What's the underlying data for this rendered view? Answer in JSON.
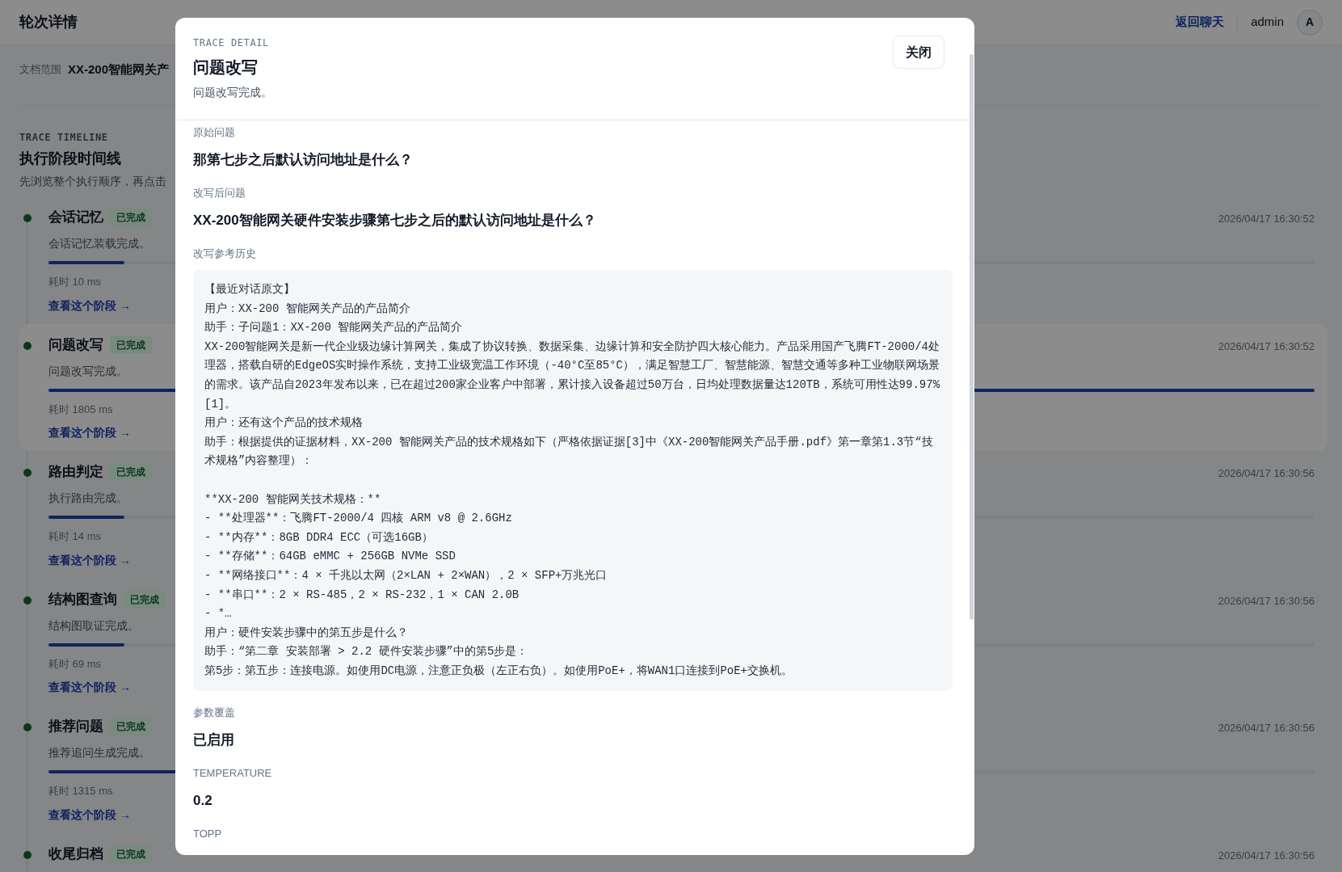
{
  "page": {
    "title": "轮次详情",
    "back_link": "返回聊天",
    "user": "admin",
    "avatar": "A"
  },
  "scope": {
    "label": "文档范围",
    "value": "XX-200智能网关产"
  },
  "timeline": {
    "eyebrow": "TRACE TIMELINE",
    "title": "执行阶段时间线",
    "hint": "先浏览整个执行顺序，再点击"
  },
  "stages": [
    {
      "name": "会话记忆",
      "status": "已完成",
      "desc": "会话记忆装载完成。",
      "level": 0.06,
      "duration": "耗时 10 ms",
      "link": "查看这个阶段 →",
      "time": "2026/04/17 16:30:52",
      "selected": false
    },
    {
      "name": "问题改写",
      "status": "已完成",
      "desc": "问题改写完成。",
      "level": 1,
      "duration": "耗时 1805 ms",
      "link": "查看这个阶段 →",
      "time": "2026/04/17 16:30:52",
      "selected": true
    },
    {
      "name": "路由判定",
      "status": "已完成",
      "desc": "执行路由完成。",
      "level": 0.06,
      "duration": "耗时 14 ms",
      "link": "查看这个阶段 →",
      "time": "2026/04/17 16:30:56",
      "selected": false
    },
    {
      "name": "结构图查询",
      "status": "已完成",
      "desc": "结构图取证完成。",
      "level": 0.06,
      "duration": "耗时 69 ms",
      "link": "查看这个阶段 →",
      "time": "2026/04/17 16:30:56",
      "selected": false
    },
    {
      "name": "推荐问题",
      "status": "已完成",
      "desc": "推荐追问生成完成。",
      "level": 0.73,
      "duration": "耗时 1315 ms",
      "link": "查看这个阶段 →",
      "time": "2026/04/17 16:30:56",
      "selected": false
    },
    {
      "name": "收尾归档",
      "status": "已完成",
      "time": "2026/04/17 16:30:56",
      "selected": false
    }
  ],
  "detail": {
    "eyebrow": "TRACE DETAIL",
    "title": "问题改写",
    "subtitle": "问题改写完成。",
    "close": "关闭",
    "fields": [
      {
        "kind": "text",
        "label": "原始问题",
        "value": "那第七步之后默认访问地址是什么？"
      },
      {
        "kind": "text",
        "label": "改写后问题",
        "value": "XX-200智能网关硬件安装步骤第七步之后的默认访问地址是什么？"
      },
      {
        "kind": "code",
        "label": "改写参考历史",
        "lines": [
          {
            "text": "【最近对话原文】",
            "space_before": false
          },
          {
            "text": "用户：XX-200 智能网关产品的产品简介",
            "space_before": false
          },
          {
            "text": "助手：子问题1：XX-200 智能网关产品的产品简介",
            "space_before": false
          },
          {
            "text": "XX-200智能网关是新一代企业级边缘计算网关，集成了协议转换、数据采集、边缘计算和安全防护四大核心能力。产品采用国产飞腾FT-2000/4处理器，搭载自研的EdgeOS实时操作系统，支持工业级宽温工作环境（-40°C至85°C），满足智慧工厂、智慧能源、智慧交通等多种工业物联网场景的需求。该产品自2023年发布以来，已在超过200家企业客户中部署，累计接入设备超过50万台，日均处理数据量达120TB，系统可用性达99.97% [1]。",
            "space_before": false
          },
          {
            "text": "用户：还有这个产品的技术规格",
            "space_before": false
          },
          {
            "text": "助手：根据提供的证据材料，XX-200 智能网关产品的技术规格如下（严格依据证据[3]中《XX-200智能网关产品手册.pdf》第一章第1.3节“技术规格”内容整理）：",
            "space_before": false
          },
          {
            "text": "**XX-200 智能网关技术规格：**",
            "space_before": true
          },
          {
            "text": "- **处理器**：飞腾FT-2000/4 四核 ARM v8 @ 2.6GHz",
            "space_before": false
          },
          {
            "text": "- **内存**：8GB DDR4 ECC（可选16GB）",
            "space_before": false
          },
          {
            "text": "- **存储**：64GB eMMC + 256GB NVMe SSD",
            "space_before": false
          },
          {
            "text": "- **网络接口**：4 × 千兆以太网（2×LAN + 2×WAN），2 × SFP+万兆光口",
            "space_before": false
          },
          {
            "text": "- **串口**：2 × RS-485，2 × RS-232，1 × CAN 2.0B",
            "space_before": false
          },
          {
            "text": "- *…",
            "space_before": false
          },
          {
            "text": "用户：硬件安装步骤中的第五步是什么？",
            "space_before": false
          },
          {
            "text": "助手：“第二章 安装部署 > 2.2 硬件安装步骤”中的第5步是：",
            "space_before": false
          },
          {
            "text": "第5步：第五步：连接电源。如使用DC电源，注意正负极（左正右负）。如使用PoE+，将WAN1口连接到PoE+交换机。",
            "space_before": false
          }
        ]
      },
      {
        "kind": "text",
        "label": "参数覆盖",
        "value": "已启用"
      },
      {
        "kind": "text",
        "label": "TEMPERATURE",
        "value": "0.2"
      },
      {
        "kind": "label",
        "label": "TOPP"
      }
    ]
  }
}
